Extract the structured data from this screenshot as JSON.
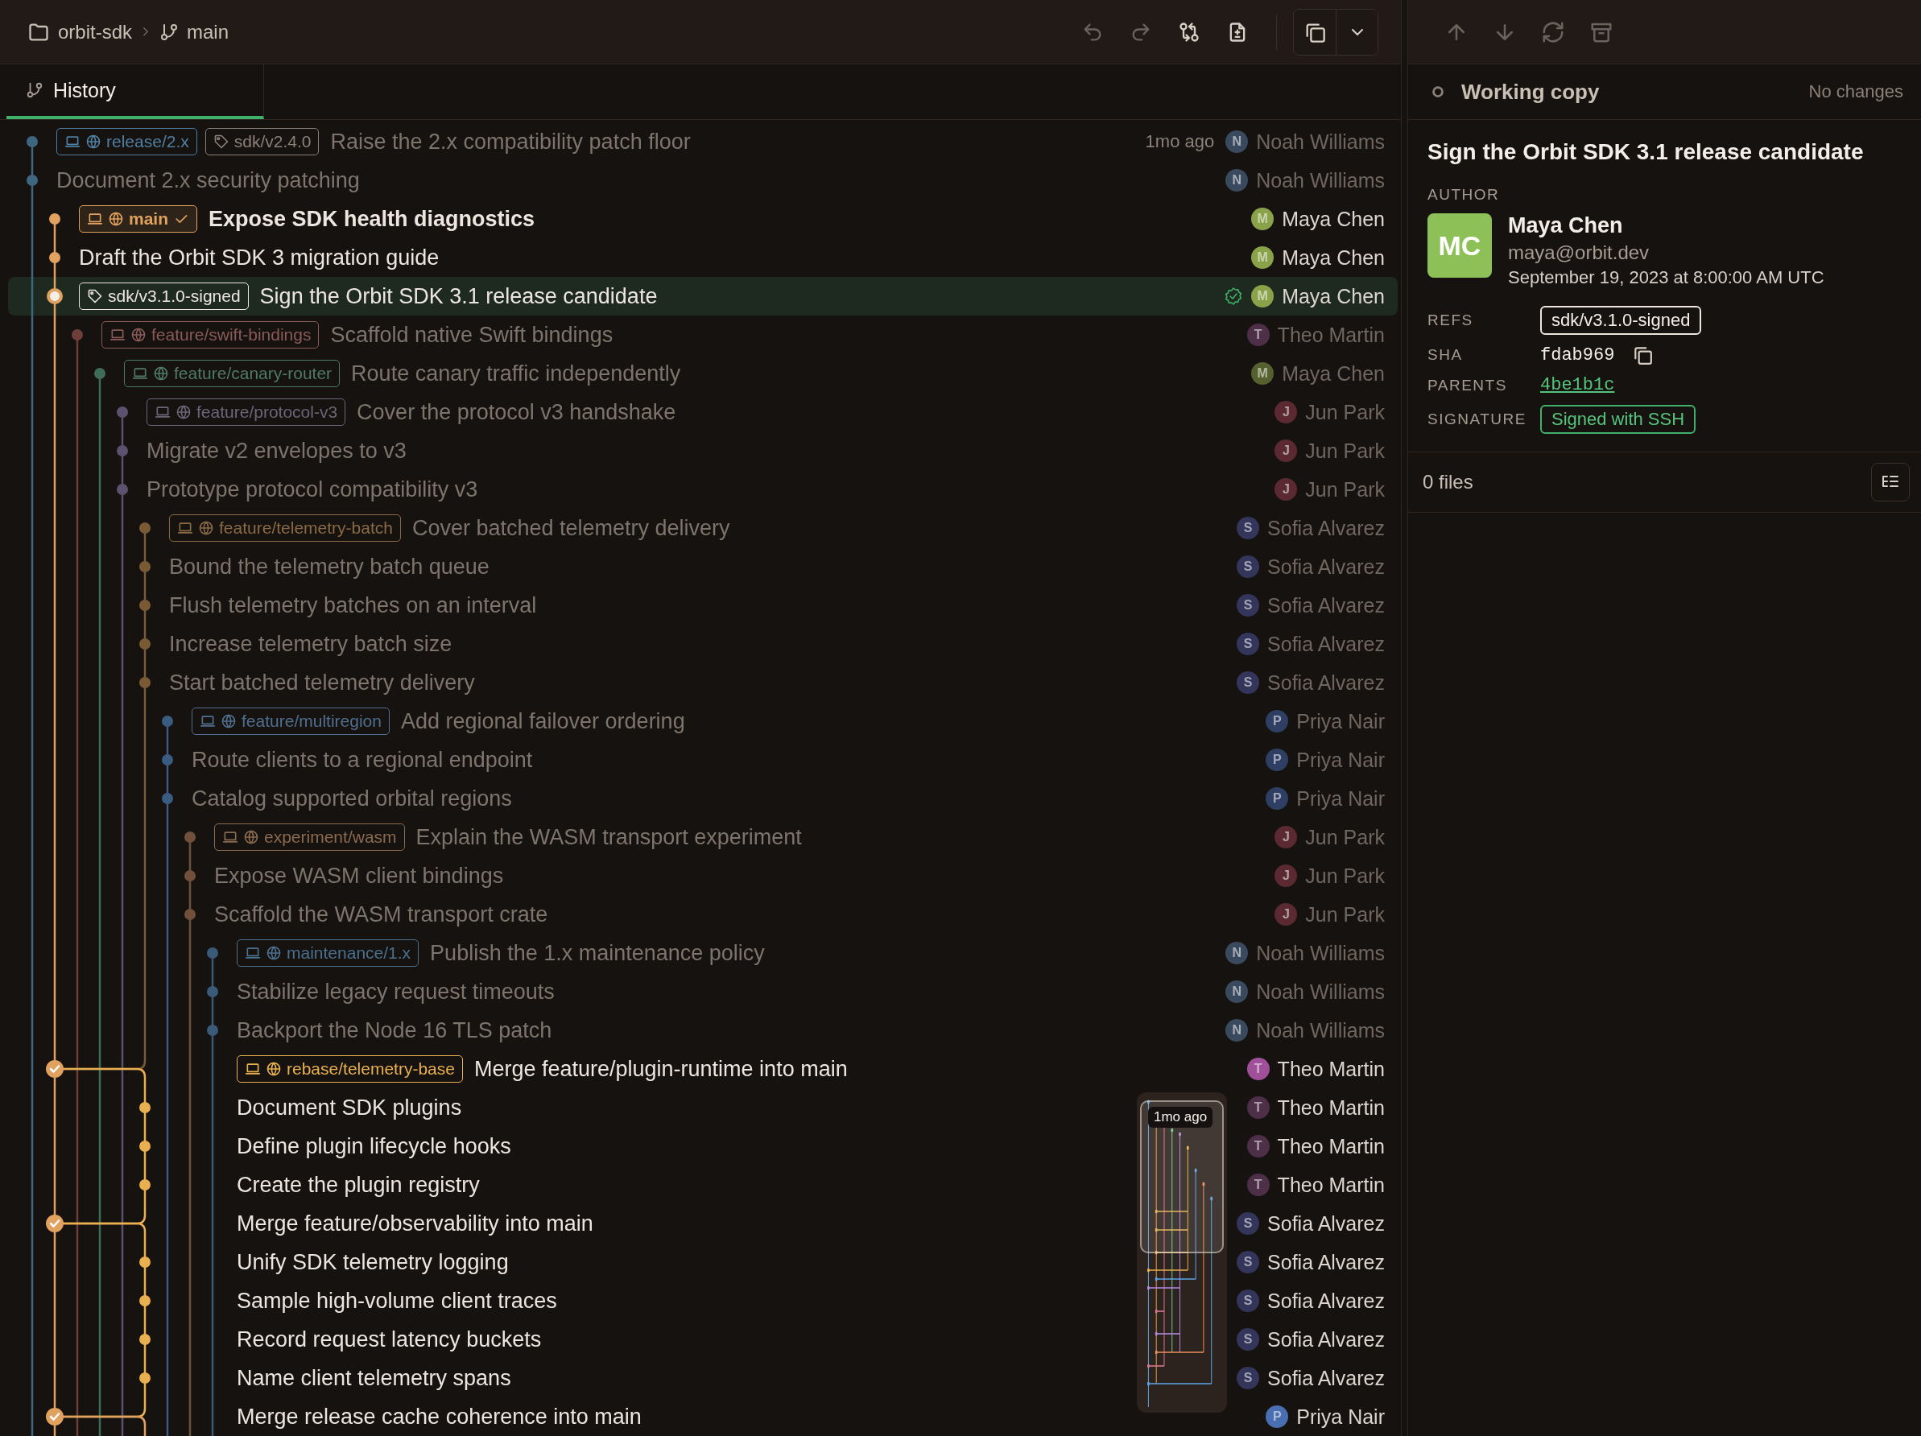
{
  "topbar": {
    "repository": "orbit-sdk",
    "branch": "main",
    "buttons": [
      {
        "kind": "undo",
        "disabled": true
      },
      {
        "kind": "redo",
        "disabled": true
      },
      {
        "kind": "compare",
        "disabled": false
      },
      {
        "kind": "file",
        "disabled": false
      }
    ]
  },
  "tabs": [
    {
      "label": "History",
      "selected": true
    }
  ],
  "rows": [
    {
      "kind": "commit",
      "color": "#3f6680",
      "dimmed": true,
      "selected": false,
      "signed": false,
      "refs": [
        {
          "kind": "branch",
          "text": "release/2.x",
          "color": "#4f7fa3",
          "current": false
        },
        {
          "kind": "tag",
          "text": "sdk/v2.4.0",
          "color": "#8a8178",
          "current": false
        }
      ],
      "message": "Raise the 2.x compatibility patch floor",
      "time": "1mo ago",
      "author": {
        "initial": "N",
        "name": "Noah Williams",
        "color": "#3a4a5e"
      }
    },
    {
      "kind": "commit",
      "color": "#3f6680",
      "dimmed": true,
      "selected": false,
      "signed": false,
      "refs": [],
      "message": "Document 2.x security patching",
      "author": {
        "initial": "N",
        "name": "Noah Williams",
        "color": "#3a4a5e"
      }
    },
    {
      "kind": "commit",
      "color": "#e0a25e",
      "dimmed": false,
      "selected": false,
      "signed": false,
      "refs": [
        {
          "kind": "branch",
          "text": "main",
          "color": "#e0a25e",
          "current": true
        }
      ],
      "message": "Expose SDK health diagnostics",
      "author": {
        "initial": "M",
        "name": "Maya Chen",
        "color": "#8aa24a"
      }
    },
    {
      "kind": "commit",
      "color": "#e0a25e",
      "dimmed": false,
      "selected": false,
      "signed": false,
      "refs": [],
      "message": "Draft the Orbit SDK 3 migration guide",
      "author": {
        "initial": "M",
        "name": "Maya Chen",
        "color": "#8aa24a"
      }
    },
    {
      "kind": "current",
      "color": "#e0a25e",
      "dimmed": false,
      "selected": true,
      "signed": true,
      "refs": [
        {
          "kind": "tag",
          "text": "sdk/v3.1.0-signed",
          "color": "#ece6df",
          "current": false
        }
      ],
      "message": "Sign the Orbit SDK 3.1 release candidate",
      "author": {
        "initial": "M",
        "name": "Maya Chen",
        "color": "#8aa24a"
      }
    },
    {
      "kind": "commit",
      "color": "#6e3f3a",
      "dimmed": true,
      "selected": false,
      "signed": false,
      "refs": [
        {
          "kind": "branch",
          "text": "feature/swift-bindings",
          "color": "#8a5a58",
          "current": false
        }
      ],
      "message": "Scaffold native Swift bindings",
      "author": {
        "initial": "T",
        "name": "Theo Martin",
        "color": "#4d2f47"
      }
    },
    {
      "kind": "commit",
      "color": "#3f6b5a",
      "dimmed": true,
      "selected": false,
      "signed": false,
      "refs": [
        {
          "kind": "branch",
          "text": "feature/canary-router",
          "color": "#4f7a68",
          "current": false
        }
      ],
      "message": "Route canary traffic independently",
      "author": {
        "initial": "M",
        "name": "Maya Chen",
        "color": "#54602e"
      }
    },
    {
      "kind": "commit",
      "color": "#5c5270",
      "dimmed": true,
      "selected": false,
      "signed": false,
      "refs": [
        {
          "kind": "branch",
          "text": "feature/protocol-v3",
          "color": "#6c6478",
          "current": false
        }
      ],
      "message": "Cover the protocol v3 handshake",
      "author": {
        "initial": "J",
        "name": "Jun Park",
        "color": "#5a2a30"
      }
    },
    {
      "kind": "commit",
      "color": "#5c5270",
      "dimmed": true,
      "selected": false,
      "signed": false,
      "refs": [],
      "message": "Migrate v2 envelopes to v3",
      "author": {
        "initial": "J",
        "name": "Jun Park",
        "color": "#5a2a30"
      }
    },
    {
      "kind": "commit",
      "color": "#5c5270",
      "dimmed": true,
      "selected": false,
      "signed": false,
      "refs": [],
      "message": "Prototype protocol compatibility v3",
      "author": {
        "initial": "J",
        "name": "Jun Park",
        "color": "#5a2a30"
      }
    },
    {
      "kind": "commit",
      "color": "#7a5a35",
      "dimmed": true,
      "selected": false,
      "signed": false,
      "refs": [
        {
          "kind": "branch",
          "text": "feature/telemetry-batch",
          "color": "#8a6a45",
          "current": false
        }
      ],
      "message": "Cover batched telemetry delivery",
      "author": {
        "initial": "S",
        "name": "Sofia Alvarez",
        "color": "#33365a"
      }
    },
    {
      "kind": "commit",
      "color": "#7a5a35",
      "dimmed": true,
      "selected": false,
      "signed": false,
      "refs": [],
      "message": "Bound the telemetry batch queue",
      "author": {
        "initial": "S",
        "name": "Sofia Alvarez",
        "color": "#33365a"
      }
    },
    {
      "kind": "commit",
      "color": "#7a5a35",
      "dimmed": true,
      "selected": false,
      "signed": false,
      "refs": [],
      "message": "Flush telemetry batches on an interval",
      "author": {
        "initial": "S",
        "name": "Sofia Alvarez",
        "color": "#33365a"
      }
    },
    {
      "kind": "commit",
      "color": "#7a5a35",
      "dimmed": true,
      "selected": false,
      "signed": false,
      "refs": [],
      "message": "Increase telemetry batch size",
      "author": {
        "initial": "S",
        "name": "Sofia Alvarez",
        "color": "#33365a"
      }
    },
    {
      "kind": "commit",
      "color": "#7a5a35",
      "dimmed": true,
      "selected": false,
      "signed": false,
      "refs": [],
      "message": "Start batched telemetry delivery",
      "author": {
        "initial": "S",
        "name": "Sofia Alvarez",
        "color": "#33365a"
      }
    },
    {
      "kind": "commit",
      "color": "#3a5c80",
      "dimmed": true,
      "selected": false,
      "signed": false,
      "refs": [
        {
          "kind": "branch",
          "text": "feature/multiregion",
          "color": "#4f6f90",
          "current": false
        }
      ],
      "message": "Add regional failover ordering",
      "author": {
        "initial": "P",
        "name": "Priya Nair",
        "color": "#2f3f63"
      }
    },
    {
      "kind": "commit",
      "color": "#3a5c80",
      "dimmed": true,
      "selected": false,
      "signed": false,
      "refs": [],
      "message": "Route clients to a regional endpoint",
      "author": {
        "initial": "P",
        "name": "Priya Nair",
        "color": "#2f3f63"
      }
    },
    {
      "kind": "commit",
      "color": "#3a5c80",
      "dimmed": true,
      "selected": false,
      "signed": false,
      "refs": [],
      "message": "Catalog supported orbital regions",
      "author": {
        "initial": "P",
        "name": "Priya Nair",
        "color": "#2f3f63"
      }
    },
    {
      "kind": "commit",
      "color": "#70503a",
      "dimmed": true,
      "selected": false,
      "signed": false,
      "refs": [
        {
          "kind": "branch",
          "text": "experiment/wasm",
          "color": "#8a6a50",
          "current": false
        }
      ],
      "message": "Explain the WASM transport experiment",
      "author": {
        "initial": "J",
        "name": "Jun Park",
        "color": "#5a2a30"
      }
    },
    {
      "kind": "commit",
      "color": "#70503a",
      "dimmed": true,
      "selected": false,
      "signed": false,
      "refs": [],
      "message": "Expose WASM client bindings",
      "author": {
        "initial": "J",
        "name": "Jun Park",
        "color": "#5a2a30"
      }
    },
    {
      "kind": "commit",
      "color": "#70503a",
      "dimmed": true,
      "selected": false,
      "signed": false,
      "refs": [],
      "message": "Scaffold the WASM transport crate",
      "author": {
        "initial": "J",
        "name": "Jun Park",
        "color": "#5a2a30"
      }
    },
    {
      "kind": "commit",
      "color": "#3a5a7a",
      "dimmed": true,
      "selected": false,
      "signed": false,
      "refs": [
        {
          "kind": "branch",
          "text": "maintenance/1.x",
          "color": "#4a7090",
          "current": false
        }
      ],
      "message": "Publish the 1.x maintenance policy",
      "author": {
        "initial": "N",
        "name": "Noah Williams",
        "color": "#3a4a5e"
      }
    },
    {
      "kind": "commit",
      "color": "#3a5a7a",
      "dimmed": true,
      "selected": false,
      "signed": false,
      "refs": [],
      "message": "Stabilize legacy request timeouts",
      "author": {
        "initial": "N",
        "name": "Noah Williams",
        "color": "#3a4a5e"
      }
    },
    {
      "kind": "commit",
      "color": "#3a5a7a",
      "dimmed": true,
      "selected": false,
      "signed": false,
      "refs": [],
      "message": "Backport the Node 16 TLS patch",
      "author": {
        "initial": "N",
        "name": "Noah Williams",
        "color": "#3a4a5e"
      }
    },
    {
      "kind": "merge",
      "color": "#e0a25e",
      "dimmed": false,
      "selected": false,
      "signed": false,
      "refs": [
        {
          "kind": "branch",
          "text": "rebase/telemetry-base",
          "color": "#e8b04e",
          "current": false
        }
      ],
      "message": "Merge feature/plugin-runtime into main",
      "author": {
        "initial": "T",
        "name": "Theo Martin",
        "color": "#a0509a"
      }
    },
    {
      "kind": "commit",
      "color": "#e8b04e",
      "dimmed": false,
      "selected": false,
      "signed": false,
      "refs": [],
      "message": "Document SDK plugins",
      "author": {
        "initial": "T",
        "name": "Theo Martin",
        "color": "#4d2f47"
      }
    },
    {
      "kind": "commit",
      "color": "#e8b04e",
      "dimmed": false,
      "selected": false,
      "signed": false,
      "refs": [],
      "message": "Define plugin lifecycle hooks",
      "author": {
        "initial": "T",
        "name": "Theo Martin",
        "color": "#4d2f47"
      }
    },
    {
      "kind": "commit",
      "color": "#e8b04e",
      "dimmed": false,
      "selected": false,
      "signed": false,
      "refs": [],
      "message": "Create the plugin registry",
      "author": {
        "initial": "T",
        "name": "Theo Martin",
        "color": "#4d2f47"
      }
    },
    {
      "kind": "merge",
      "color": "#e0a25e",
      "dimmed": false,
      "selected": false,
      "signed": false,
      "refs": [],
      "message": "Merge feature/observability into main",
      "author": {
        "initial": "S",
        "name": "Sofia Alvarez",
        "color": "#33365a"
      }
    },
    {
      "kind": "commit",
      "color": "#e8b04e",
      "dimmed": false,
      "selected": false,
      "signed": false,
      "refs": [],
      "message": "Unify SDK telemetry logging",
      "author": {
        "initial": "S",
        "name": "Sofia Alvarez",
        "color": "#33365a"
      }
    },
    {
      "kind": "commit",
      "color": "#e8b04e",
      "dimmed": false,
      "selected": false,
      "signed": false,
      "refs": [],
      "message": "Sample high-volume client traces",
      "author": {
        "initial": "S",
        "name": "Sofia Alvarez",
        "color": "#33365a"
      }
    },
    {
      "kind": "commit",
      "color": "#e8b04e",
      "dimmed": false,
      "selected": false,
      "signed": false,
      "refs": [],
      "message": "Record request latency buckets",
      "author": {
        "initial": "S",
        "name": "Sofia Alvarez",
        "color": "#33365a"
      }
    },
    {
      "kind": "commit",
      "color": "#e8b04e",
      "dimmed": false,
      "selected": false,
      "signed": false,
      "refs": [],
      "message": "Name client telemetry spans",
      "author": {
        "initial": "S",
        "name": "Sofia Alvarez",
        "color": "#33365a"
      }
    },
    {
      "kind": "merge",
      "color": "#e0a25e",
      "dimmed": false,
      "selected": false,
      "signed": false,
      "refs": [],
      "message": "Merge release cache coherence into main",
      "author": {
        "initial": "P",
        "name": "Priya Nair",
        "color": "#4a6fb0"
      }
    }
  ],
  "minimap": {
    "tooltip": "1mo ago"
  },
  "panel": {
    "buttons": [
      {
        "kind": "up",
        "disabled": true
      },
      {
        "kind": "down",
        "disabled": true
      },
      {
        "kind": "refresh",
        "disabled": true
      },
      {
        "kind": "archive",
        "disabled": true
      }
    ],
    "working_copy": {
      "label": "Working copy",
      "status": "No changes"
    },
    "title": "Sign the Orbit SDK 3.1 release candidate",
    "author_label": "AUTHOR",
    "author": {
      "initials": "MC",
      "color": "#8dc056",
      "name": "Maya Chen",
      "email": "maya@orbit.dev",
      "date": "September 19, 2023 at 8:00:00 AM UTC"
    },
    "fields": [
      {
        "kind": "tag",
        "label": "REFS",
        "value": "sdk/v3.1.0-signed"
      },
      {
        "kind": "sha",
        "label": "SHA",
        "value": "fdab969"
      },
      {
        "kind": "link",
        "label": "PARENTS",
        "value": "4be1b1c"
      },
      {
        "kind": "badge",
        "label": "SIGNATURE",
        "value": "Signed with SSH"
      }
    ],
    "files": "0 files"
  }
}
